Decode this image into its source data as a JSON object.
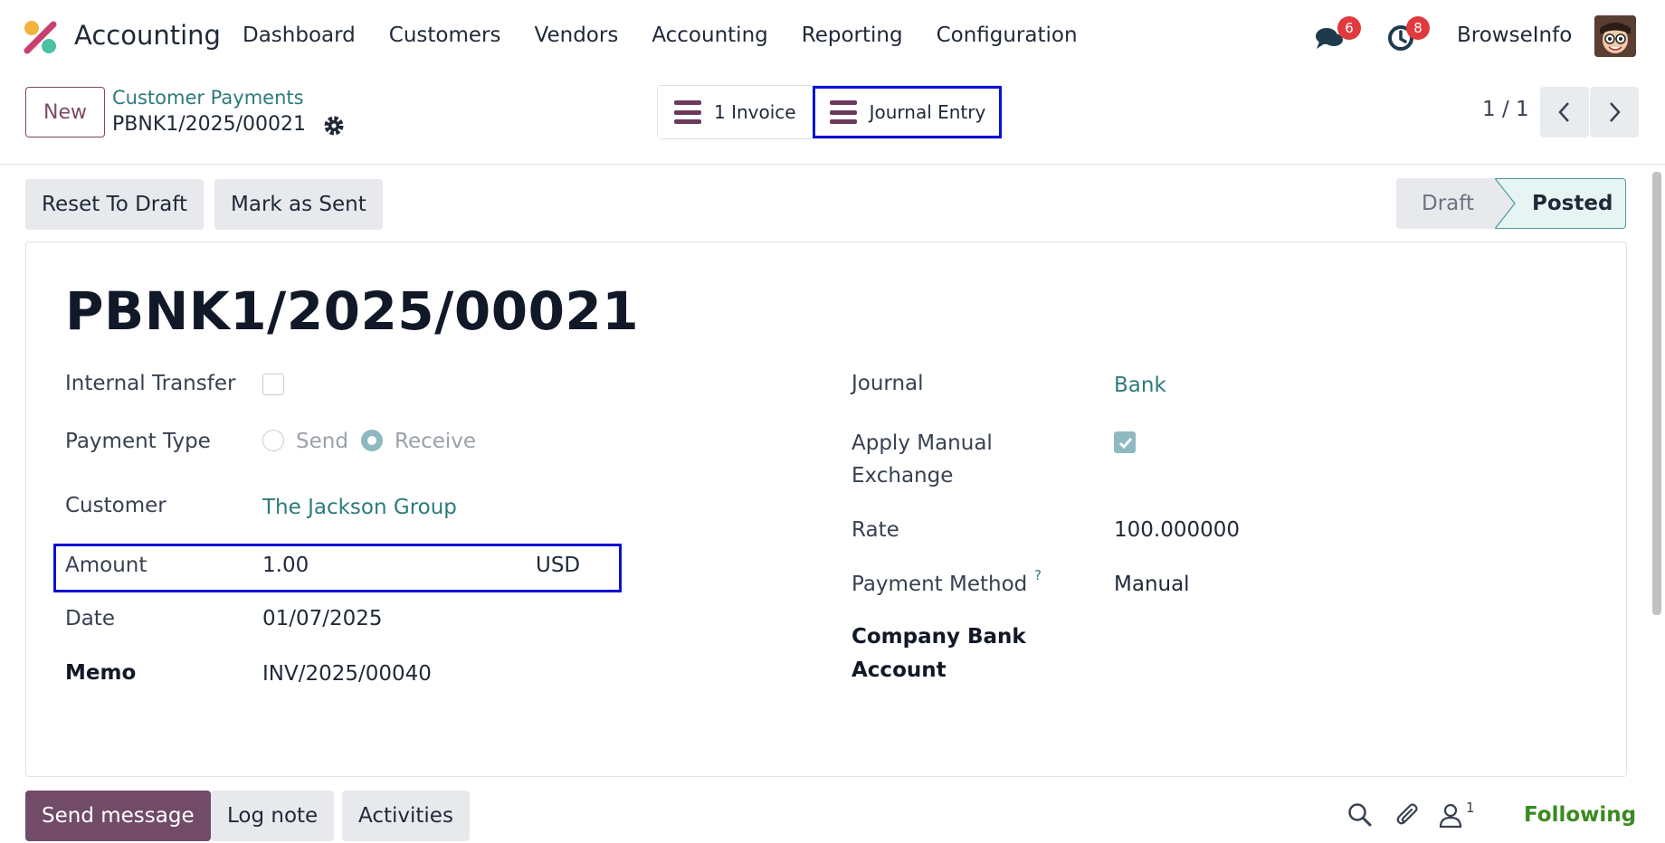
{
  "navbar": {
    "app_name": "Accounting",
    "menu": [
      "Dashboard",
      "Customers",
      "Vendors",
      "Accounting",
      "Reporting",
      "Configuration"
    ],
    "messages_badge": "6",
    "activities_badge": "8",
    "user_name": "BrowseInfo"
  },
  "control_panel": {
    "new_label": "New",
    "breadcrumb_parent": "Customer Payments",
    "breadcrumb_current": "PBNK1/2025/00021",
    "smart_buttons": [
      "1 Invoice",
      "Journal Entry"
    ],
    "pager": "1 / 1"
  },
  "actions": {
    "reset_to_draft": "Reset To Draft",
    "mark_as_sent": "Mark as Sent"
  },
  "statusbar": {
    "draft": "Draft",
    "posted": "Posted",
    "current": "Posted"
  },
  "form": {
    "title": "PBNK1/2025/00021",
    "internal_transfer": {
      "label": "Internal Transfer",
      "checked": false
    },
    "payment_type": {
      "label": "Payment Type",
      "options": [
        "Send",
        "Receive"
      ],
      "selected": "Receive"
    },
    "customer": {
      "label": "Customer",
      "value": "The Jackson Group"
    },
    "amount": {
      "label": "Amount",
      "value": "1.00",
      "currency": "USD"
    },
    "date": {
      "label": "Date",
      "value": "01/07/2025"
    },
    "memo": {
      "label": "Memo",
      "value": "INV/2025/00040"
    },
    "journal": {
      "label": "Journal",
      "value": "Bank"
    },
    "apply_manual_exchange": {
      "label_line1": "Apply Manual",
      "label_line2": "Exchange",
      "checked": true
    },
    "rate": {
      "label": "Rate",
      "value": "100.000000"
    },
    "payment_method": {
      "label": "Payment Method",
      "help": "?",
      "value": "Manual"
    },
    "company_bank_account": {
      "label_line1": "Company Bank",
      "label_line2": "Account"
    }
  },
  "chatter": {
    "send_message": "Send message",
    "log_note": "Log note",
    "activities": "Activities",
    "followers_count": "1",
    "following": "Following"
  },
  "colors": {
    "brand": "#714b67",
    "link": "#2d7a7c",
    "highlight": "#0a10d6",
    "badge": "#e03a3e",
    "following": "#3a8a22"
  }
}
